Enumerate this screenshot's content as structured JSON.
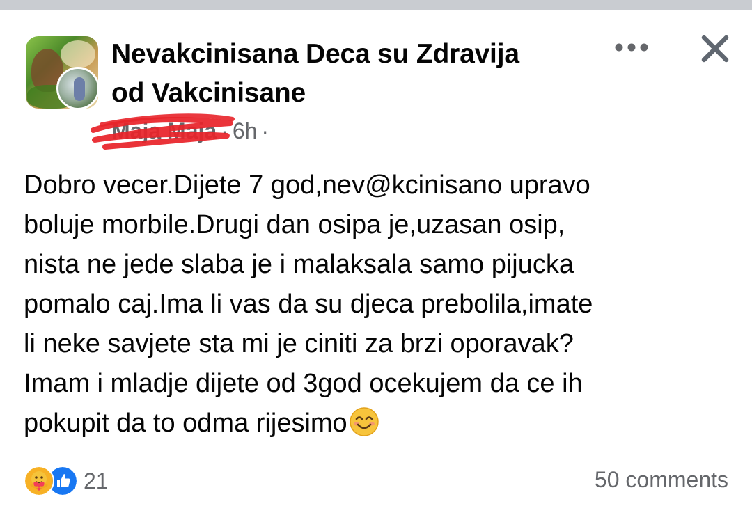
{
  "post": {
    "group_name_line1": "Nevakcinisana Deca su Zdravija",
    "group_name_line2": "od Vakcinisane",
    "author": "Maja Maja",
    "separator": "·",
    "time": "6h",
    "body": "Dobro vecer.Dijete 7 god,nev@kcinisano upravo\nboluje morbile.Drugi dan osipa je,uzasan osip,\nnista ne jede slaba je i malaksala samo pijucka\npomalo caj.Ima li vas da su djeca prebolila,imate\nli neke savjete sta mi je ciniti za brzi oporavak?\nImam i mladje dijete od 3god ocekujem da ce ih\npokupit da to odma rijesimo",
    "body_emoji": "smiling-face-with-smiling-eyes"
  },
  "footer": {
    "reaction_icons": [
      "care-reaction-icon",
      "like-reaction-icon"
    ],
    "reaction_count": "21",
    "comments": "50 comments"
  },
  "colors": {
    "text": "#050505",
    "secondary": "#65676b",
    "like_blue": "#1877f2",
    "care_yellow": "#f7b125",
    "scribble_red": "#e8242a"
  }
}
